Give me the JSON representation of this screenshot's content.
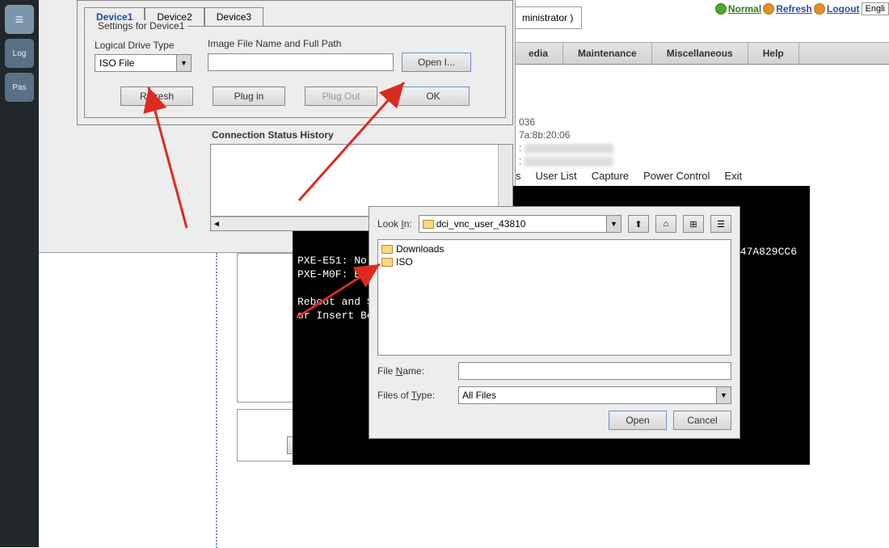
{
  "sidebar": {
    "item1": "≡",
    "item2": "Log",
    "item3": "Pas"
  },
  "header": {
    "normal": "Normal",
    "refresh": "Refresh",
    "logout": "Logout",
    "lang": "Engli"
  },
  "admin_box": "ministrator )",
  "menu": {
    "media": "edia",
    "maintenance": "Maintenance",
    "misc": "Miscellaneous",
    "help": "Help"
  },
  "device_dialog": {
    "tabs": [
      "Device1",
      "Device2",
      "Device3"
    ],
    "settings_title": "Settings for Device1",
    "drive_type_label": "Logical Drive Type",
    "drive_type_value": "ISO File",
    "image_path_label": "Image File Name and Full Path",
    "open_btn": "Open I...",
    "refresh_btn": "Refresh",
    "plugin_btn": "Plug in",
    "plugout_btn": "Plug Out",
    "ok_btn": "OK",
    "status_title": "Connection Status History"
  },
  "info": {
    "line1": "036",
    "line2": "7a:8b:20:06",
    "colon": ":"
  },
  "sec_menu": [
    "s",
    "User List",
    "Capture",
    "Power Control",
    "Exit"
  ],
  "terminal": {
    "lines": "PXE-E51: No\nPXE-M0F: Ex\n\nReboot and S\nor Insert Bo",
    "corner": "47A829CC6"
  },
  "file_dialog": {
    "look_in": "Look In:",
    "look_in_value": "dci_vnc_user_43810",
    "folders": [
      "Downloads",
      "ISO"
    ],
    "file_name_label": "File Name:",
    "file_type_label": "Files of Type:",
    "file_type_value": "All Files",
    "open": "Open",
    "cancel": "Cancel",
    "name_u": "N",
    "type_u": "T",
    "in_u": "I"
  }
}
